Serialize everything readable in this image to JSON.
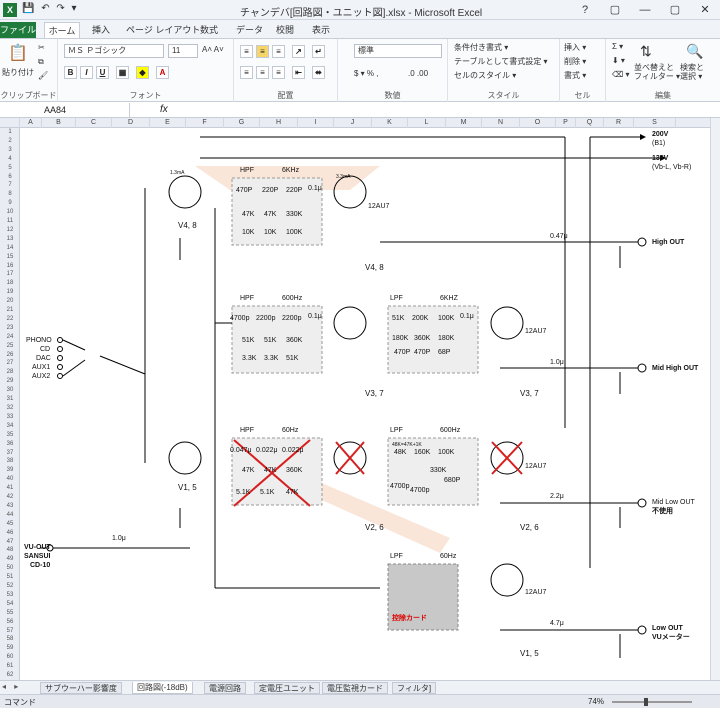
{
  "window": {
    "title": "チャンデバ[回路図・ユニット図].xlsx - Microsoft Excel",
    "app_icon": "X",
    "qat_icons": [
      "save-icon",
      "undo-icon",
      "redo-icon",
      "customize-icon"
    ],
    "controls": [
      "?",
      "▢",
      "—",
      "▢",
      "✕"
    ]
  },
  "tabs": [
    "ファイル",
    "ホーム",
    "挿入",
    "ページ レイアウト",
    "数式",
    "データ",
    "校閲",
    "表示"
  ],
  "ribbon": {
    "clipboard": {
      "label": "クリップボード",
      "paste": "貼り付け"
    },
    "font": {
      "label": "フォント",
      "font_name": "ＭＳ Ｐゴシック",
      "font_size": "11"
    },
    "align": {
      "label": "配置"
    },
    "number": {
      "label": "数値",
      "format": "標準"
    },
    "styles": {
      "label": "スタイル",
      "items": [
        "条件付き書式 ▾",
        "テーブルとして書式設定 ▾",
        "セルのスタイル ▾"
      ]
    },
    "cells": {
      "label": "セル",
      "items": [
        "挿入 ▾",
        "削除 ▾",
        "書式 ▾"
      ]
    },
    "edit": {
      "label": "編集",
      "sort": "並べ替えと\nフィルター ▾",
      "find": "検索と\n選択 ▾"
    }
  },
  "formula_bar": {
    "name_box": "AA84",
    "fx": "fx",
    "value": ""
  },
  "columns": [
    "A",
    "B",
    "C",
    "D",
    "E",
    "F",
    "G",
    "H",
    "I",
    "J",
    "K",
    "L",
    "M",
    "N",
    "O",
    "P",
    "Q",
    "R",
    "S"
  ],
  "rows": [
    "1",
    "2",
    "3",
    "4",
    "5",
    "6",
    "7",
    "8",
    "9",
    "10",
    "11",
    "12",
    "13",
    "14",
    "15",
    "16",
    "17",
    "18",
    "19",
    "20",
    "21",
    "22",
    "23",
    "24",
    "25",
    "26",
    "27",
    "28",
    "29",
    "30",
    "31",
    "32",
    "33",
    "34",
    "35",
    "36",
    "37",
    "38",
    "39",
    "40",
    "41",
    "42",
    "43",
    "44",
    "45",
    "46",
    "47",
    "48",
    "49",
    "50",
    "51",
    "52",
    "53",
    "54",
    "55",
    "56",
    "57",
    "58",
    "59",
    "60",
    "61",
    "62"
  ],
  "schematic": {
    "right_labels": [
      "200V",
      "(B1)",
      "136V",
      "(Vb-L, Vb-R)",
      "High OUT",
      "Mid High OUT",
      "Mid Low OUT",
      "不使用",
      "Low OUT",
      "VUメーター"
    ],
    "inputs": [
      "PHONO",
      "CD",
      "DAC",
      "AUX1",
      "AUX2"
    ],
    "vu_in": [
      "VU-OUT",
      "SANSUI",
      "CD-10"
    ],
    "filters": [
      {
        "type": "HPF",
        "freq": "6KHz",
        "caps": [
          "470P",
          "220P",
          "220P"
        ],
        "res1": [
          "47K",
          "47K",
          "330K"
        ],
        "res2": [
          "10K",
          "10K",
          "100K"
        ]
      },
      {
        "type": "HPF",
        "freq": "600Hz",
        "caps": [
          "4700p",
          "2200p",
          "2200p"
        ],
        "res1": [
          "51K",
          "51K",
          "360K"
        ],
        "res2": [
          "3.3K",
          "3.3K",
          "51K"
        ]
      },
      {
        "type": "LPF",
        "freq": "6KHZ",
        "res": [
          "51K",
          "200K",
          "100K"
        ],
        "res2": [
          "180K",
          "360K",
          "180K"
        ],
        "caps": [
          "470P",
          "470P",
          "68P"
        ]
      },
      {
        "type": "HPF",
        "freq": "60Hz",
        "caps": [
          "0.047μ",
          "0.022μ",
          "0.022μ"
        ],
        "res1": [
          "47K",
          "47K",
          "360K"
        ],
        "res2": [
          "5.1K",
          "5.1K",
          "47K"
        ]
      },
      {
        "type": "LPF",
        "freq": "600Hz",
        "res": [
          "48K",
          "160K",
          "100K"
        ],
        "res2": [
          "330K"
        ],
        "caps": [
          "4700p",
          "4700p",
          "680P"
        ],
        "note": "48K=47K+1K"
      },
      {
        "type": "LPF",
        "freq": "60Hz",
        "card": "控除カード"
      }
    ],
    "stages": [
      "V4, 8",
      "V4, 8",
      "V3, 7",
      "V3, 7",
      "V1, 5",
      "V2, 6",
      "V2, 6",
      "V1, 5"
    ],
    "tube": "12AU7",
    "couplings": [
      "0.1μ",
      "0.1μ",
      "0.1μ",
      "0.47μ",
      "1.0μ",
      "2.2μ",
      "4.7μ",
      "1.0μ"
    ],
    "currents": [
      "1.3mA",
      "3.3mA"
    ]
  },
  "sheet_tabs": [
    "サブウーハー影響度",
    "回路図(-18dB)",
    "電源回路",
    "定電圧ユニット",
    "電圧監視カード",
    "フィルタ]"
  ],
  "status": {
    "ready": "コマンド",
    "zoom": "74%"
  }
}
